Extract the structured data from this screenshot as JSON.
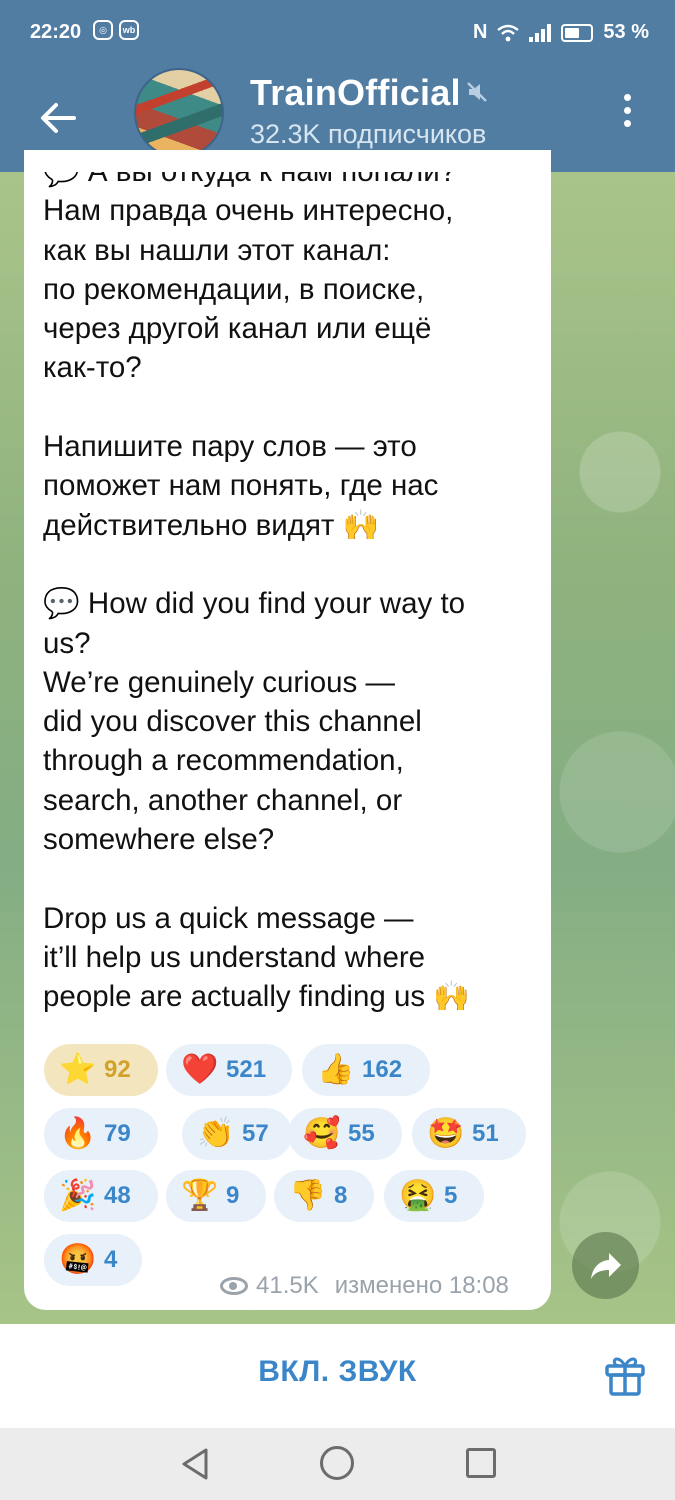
{
  "status_bar": {
    "time": "22:20",
    "left_icons": [
      "instagram-icon",
      "wb-app-icon"
    ],
    "battery": "53 %",
    "right_icons": [
      "nfc-icon",
      "wifi-icon",
      "signal-icon",
      "battery-icon"
    ]
  },
  "header": {
    "title": "TrainOfficial",
    "subtitle": "32.3K подписчиков",
    "muted": true
  },
  "message": {
    "text": "💬 А вы откуда к нам попали?\nНам правда очень интересно,\nкак вы нашли этот канал:\nпо рекомендации, в поиске,\nчерез другой канал или ещё\nкак-то?\n\nНапишите пару слов — это\nпоможет нам понять, где нас\nдействительно видят 🙌\n\n💬 How did you find your way to\nus?\nWe’re genuinely curious —\ndid you discover this channel\nthrough a recommendation,\nsearch, another channel, or\nsomewhere else?\n\nDrop us a quick message —\nit’ll help us understand where\npeople are actually finding us 🙌",
    "views": "41.5K",
    "edited_label": "изменено 18:08"
  },
  "reactions": [
    {
      "emoji": "⭐",
      "count": "92",
      "paid": true
    },
    {
      "emoji": "❤️",
      "count": "521"
    },
    {
      "emoji": "👍",
      "count": "162"
    },
    {
      "emoji": "🔥",
      "count": "79"
    },
    {
      "emoji": "👏",
      "count": "57"
    },
    {
      "emoji": "🥰",
      "count": "55"
    },
    {
      "emoji": "🤩",
      "count": "51"
    },
    {
      "emoji": "🎉",
      "count": "48"
    },
    {
      "emoji": "🏆",
      "count": "9"
    },
    {
      "emoji": "👎",
      "count": "8"
    },
    {
      "emoji": "🤮",
      "count": "5"
    },
    {
      "emoji": "🤬",
      "count": "4"
    }
  ],
  "bottom_bar": {
    "unmute_label": "ВКЛ. ЗВУК"
  },
  "colors": {
    "header_bg": "#517da2",
    "accent": "#3a86c8",
    "paid_reaction_bg": "#f3e6bf",
    "reaction_bg": "#e8f1fa"
  }
}
